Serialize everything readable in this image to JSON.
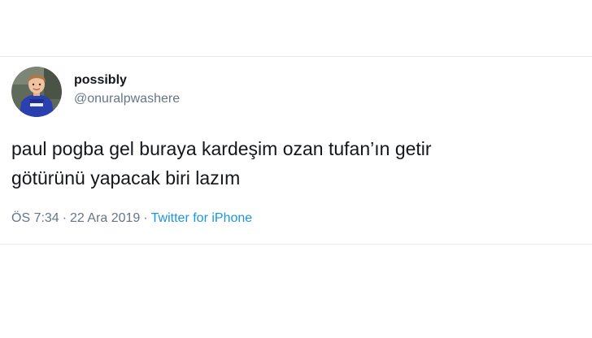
{
  "tweet": {
    "author": {
      "display_name": "possibly",
      "handle": "@onuralpwashere",
      "avatar_icon": "profile-photo-child-in-blue-jersey"
    },
    "text_lines": [
      "paul pogba gel buraya kardeşim ozan tufan’ın getir",
      "götürünü yapacak biri lazım"
    ],
    "time": "ÖS 7:34",
    "separator": "·",
    "date": "22 Ara 2019",
    "source": "Twitter for iPhone"
  },
  "colors": {
    "text": "#14171a",
    "secondary": "#657786",
    "link": "#1b95e0",
    "divider": "#e6ecf0"
  }
}
